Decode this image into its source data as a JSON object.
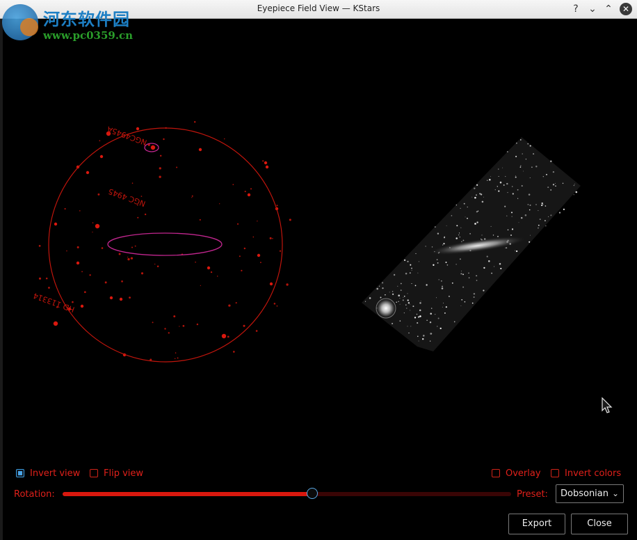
{
  "window": {
    "title": "Eyepiece Field View — KStars",
    "help_glyph": "?",
    "minimize_glyph": "⌄",
    "maximize_glyph": "⌃",
    "close_glyph": "✕"
  },
  "watermark": {
    "title": "河东软件园",
    "url": "www.pc0359.cn"
  },
  "sketch": {
    "labels": [
      "NGC4945A",
      "NGC 4945",
      "HD 113314"
    ],
    "color": "#d9180e",
    "highlight_color": "#c2268f"
  },
  "controls": {
    "invert_view_label": "Invert view",
    "invert_view_checked": true,
    "flip_view_label": "Flip view",
    "flip_view_checked": false,
    "overlay_label": "Overlay",
    "overlay_checked": false,
    "invert_colors_label": "Invert colors",
    "invert_colors_checked": false,
    "rotation_label": "Rotation:",
    "rotation_fraction": 0.557,
    "preset_label": "Preset:",
    "preset_value": "Dobsonian",
    "export_label": "Export",
    "close_label": "Close"
  },
  "colors": {
    "accent_red": "#e0201a",
    "accent_blue": "#4aa4e6"
  }
}
